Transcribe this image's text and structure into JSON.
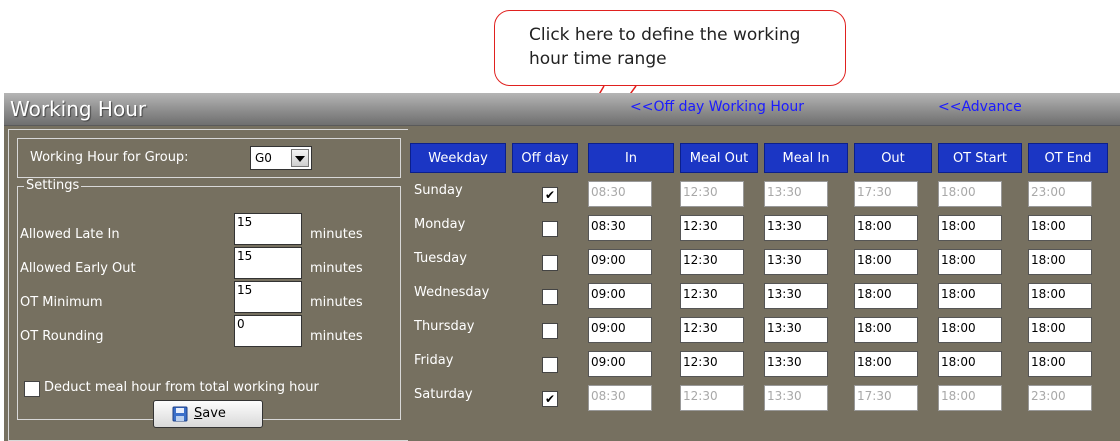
{
  "callout": {
    "text": "Click here to define the working hour time range"
  },
  "window": {
    "title": "Working Hour",
    "links": {
      "off_day": "<<Off day Working Hour",
      "advance": "<<Advance"
    }
  },
  "group": {
    "label": "Working Hour for Group:",
    "value": "G0"
  },
  "settings": {
    "legend": "Settings",
    "unit": "minutes",
    "allowed_late_in": {
      "label": "Allowed Late In",
      "value": "15"
    },
    "allowed_early_out": {
      "label": "Allowed Early Out",
      "value": "15"
    },
    "ot_minimum": {
      "label": "OT Minimum",
      "value": "15"
    },
    "ot_rounding": {
      "label": "OT Rounding",
      "value": "0"
    },
    "deduct_meal": {
      "label": "Deduct meal hour from total working hour",
      "checked": false
    }
  },
  "save_button": {
    "label": "Save",
    "mnemonic": "S",
    "rest": "ave"
  },
  "table": {
    "headers": [
      "Weekday",
      "Off day",
      "In",
      "Meal Out",
      "Meal In",
      "Out",
      "OT Start",
      "OT End"
    ],
    "rows": [
      {
        "day": "Sunday",
        "off": true,
        "check": "✔",
        "times": [
          "08:30",
          "12:30",
          "13:30",
          "17:30",
          "18:00",
          "23:00"
        ]
      },
      {
        "day": "Monday",
        "off": false,
        "check": "",
        "times": [
          "08:30",
          "12:30",
          "13:30",
          "18:00",
          "18:00",
          "18:00"
        ]
      },
      {
        "day": "Tuesday",
        "off": false,
        "check": "",
        "times": [
          "09:00",
          "12:30",
          "13:30",
          "18:00",
          "18:00",
          "18:00"
        ]
      },
      {
        "day": "Wednesday",
        "off": false,
        "check": "",
        "times": [
          "09:00",
          "12:30",
          "13:30",
          "18:00",
          "18:00",
          "18:00"
        ]
      },
      {
        "day": "Thursday",
        "off": false,
        "check": "",
        "times": [
          "09:00",
          "12:30",
          "13:30",
          "18:00",
          "18:00",
          "18:00"
        ]
      },
      {
        "day": "Friday",
        "off": false,
        "check": "",
        "times": [
          "09:00",
          "12:30",
          "13:30",
          "18:00",
          "18:00",
          "18:00"
        ]
      },
      {
        "day": "Saturday",
        "off": true,
        "check": "✔",
        "times": [
          "08:30",
          "12:30",
          "13:30",
          "17:30",
          "18:00",
          "23:00"
        ]
      }
    ]
  },
  "colors": {
    "window_bg": "#767060",
    "header_blue": "#1b36c4",
    "link_blue": "#1b1bff",
    "callout_red": "#e0211f"
  },
  "icons": {
    "save": "floppy-disk-icon",
    "dropdown": "chevron-down-icon"
  }
}
